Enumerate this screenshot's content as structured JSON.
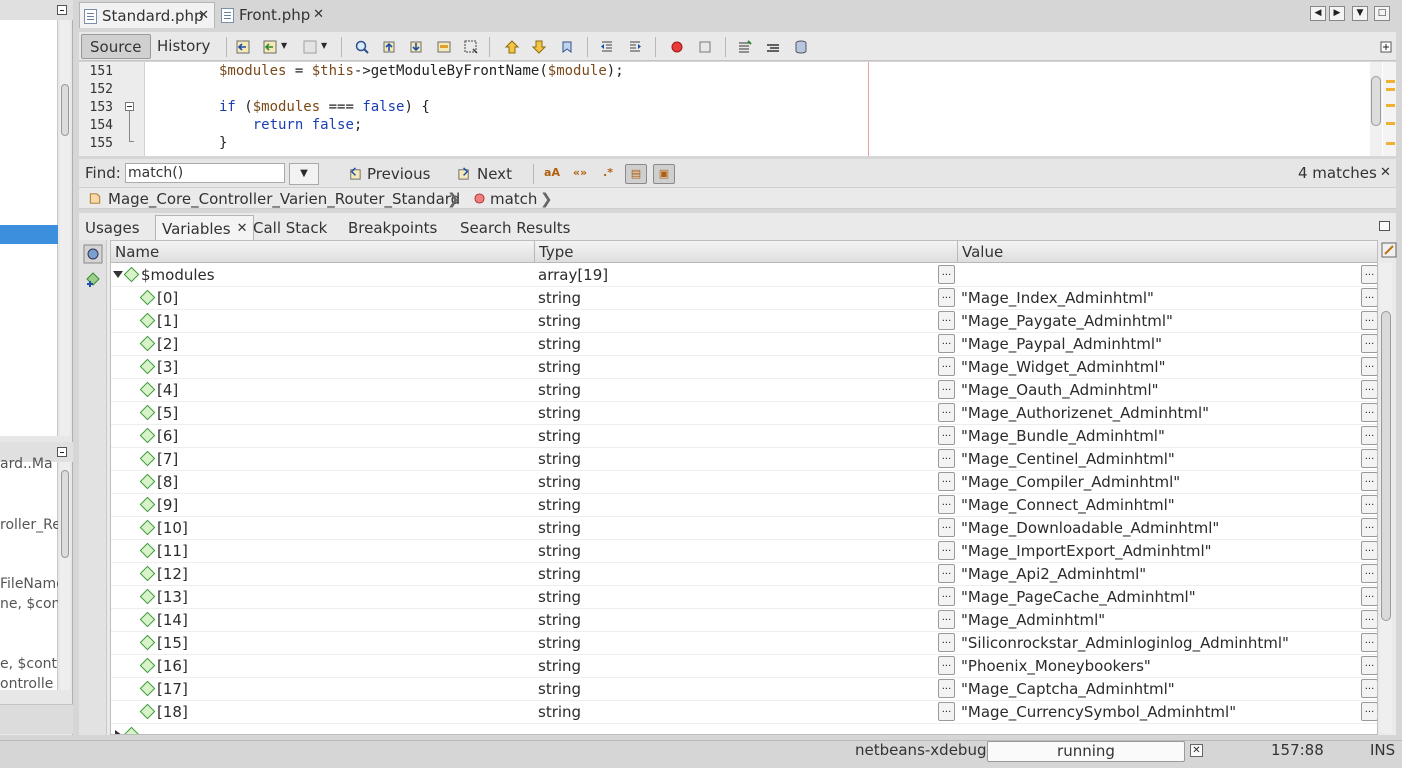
{
  "editor_tabs": [
    {
      "label": "Standard.php",
      "active": true
    },
    {
      "label": "Front.php",
      "active": false
    }
  ],
  "toolbar": {
    "source_label": "Source",
    "history_label": "History"
  },
  "code_lines": [
    {
      "num": "151",
      "text": "$modules = $this->getModuleByFrontName($module);"
    },
    {
      "num": "152",
      "text": ""
    },
    {
      "num": "153",
      "text": "if ($modules === false) {"
    },
    {
      "num": "154",
      "text": "    return false;"
    },
    {
      "num": "155",
      "text": "}"
    }
  ],
  "find": {
    "label": "Find:",
    "value": "match()",
    "previous_label": "Previous",
    "next_label": "Next",
    "matches": "4 matches"
  },
  "breadcrumb": {
    "class_name": "Mage_Core_Controller_Varien_Router_Standard",
    "method": "match"
  },
  "debug_tabs": [
    "Usages",
    "Variables",
    "Call Stack",
    "Breakpoints",
    "Search Results"
  ],
  "table": {
    "col_name": "Name",
    "col_type": "Type",
    "col_value": "Value",
    "parent": {
      "name": "$modules",
      "type": "array[19]"
    },
    "rows": [
      {
        "name": "[0]",
        "type": "string",
        "value": "\"Mage_Index_Adminhtml\""
      },
      {
        "name": "[1]",
        "type": "string",
        "value": "\"Mage_Paygate_Adminhtml\""
      },
      {
        "name": "[2]",
        "type": "string",
        "value": "\"Mage_Paypal_Adminhtml\""
      },
      {
        "name": "[3]",
        "type": "string",
        "value": "\"Mage_Widget_Adminhtml\""
      },
      {
        "name": "[4]",
        "type": "string",
        "value": "\"Mage_Oauth_Adminhtml\""
      },
      {
        "name": "[5]",
        "type": "string",
        "value": "\"Mage_Authorizenet_Adminhtml\""
      },
      {
        "name": "[6]",
        "type": "string",
        "value": "\"Mage_Bundle_Adminhtml\""
      },
      {
        "name": "[7]",
        "type": "string",
        "value": "\"Mage_Centinel_Adminhtml\""
      },
      {
        "name": "[8]",
        "type": "string",
        "value": "\"Mage_Compiler_Adminhtml\""
      },
      {
        "name": "[9]",
        "type": "string",
        "value": "\"Mage_Connect_Adminhtml\""
      },
      {
        "name": "[10]",
        "type": "string",
        "value": "\"Mage_Downloadable_Adminhtml\""
      },
      {
        "name": "[11]",
        "type": "string",
        "value": "\"Mage_ImportExport_Adminhtml\""
      },
      {
        "name": "[12]",
        "type": "string",
        "value": "\"Mage_Api2_Adminhtml\""
      },
      {
        "name": "[13]",
        "type": "string",
        "value": "\"Mage_PageCache_Adminhtml\""
      },
      {
        "name": "[14]",
        "type": "string",
        "value": "\"Mage_Adminhtml\""
      },
      {
        "name": "[15]",
        "type": "string",
        "value": "\"Siliconrockstar_Adminloginlog_Adminhtml\""
      },
      {
        "name": "[16]",
        "type": "string",
        "value": "\"Phoenix_Moneybookers\""
      },
      {
        "name": "[17]",
        "type": "string",
        "value": "\"Mage_Captcha_Adminhtml\""
      },
      {
        "name": "[18]",
        "type": "string",
        "value": "\"Mage_CurrencySymbol_Adminhtml\""
      }
    ]
  },
  "left_fragments": [
    "ard..Ma",
    "roller_Re",
    "FileName",
    "ne, $cont",
    "e, $cont",
    "ontrolle"
  ],
  "status": {
    "session": "netbeans-xdebug",
    "state": "running",
    "position": "157:88",
    "mode": "INS"
  }
}
